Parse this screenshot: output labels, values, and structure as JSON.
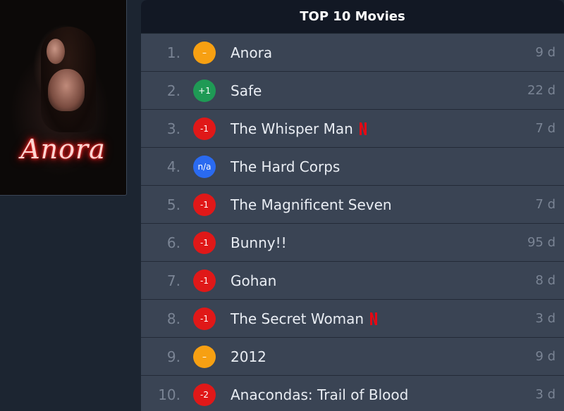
{
  "poster": {
    "title": "Anora"
  },
  "list": {
    "header": "TOP 10 Movies",
    "rows": [
      {
        "rank": "1.",
        "change": "–",
        "change_color": "#f7a012",
        "title": "Anora",
        "netflix": false,
        "days": "9 d"
      },
      {
        "rank": "2.",
        "change": "+1",
        "change_color": "#1f9a55",
        "title": "Safe",
        "netflix": false,
        "days": "22 d"
      },
      {
        "rank": "3.",
        "change": "-1",
        "change_color": "#e01818",
        "title": "The Whisper Man",
        "netflix": true,
        "days": "7 d"
      },
      {
        "rank": "4.",
        "change": "n/a",
        "change_color": "#2a6af0",
        "title": "The Hard Corps",
        "netflix": false,
        "days": ""
      },
      {
        "rank": "5.",
        "change": "-1",
        "change_color": "#e01818",
        "title": "The Magnificent Seven",
        "netflix": false,
        "days": "7 d"
      },
      {
        "rank": "6.",
        "change": "-1",
        "change_color": "#e01818",
        "title": "Bunny!!",
        "netflix": false,
        "days": "95 d"
      },
      {
        "rank": "7.",
        "change": "-1",
        "change_color": "#e01818",
        "title": "Gohan",
        "netflix": false,
        "days": "8 d"
      },
      {
        "rank": "8.",
        "change": "-1",
        "change_color": "#e01818",
        "title": "The Secret Woman",
        "netflix": true,
        "days": "3 d"
      },
      {
        "rank": "9.",
        "change": "–",
        "change_color": "#f7a012",
        "title": "2012",
        "netflix": false,
        "days": "9 d"
      },
      {
        "rank": "10.",
        "change": "-2",
        "change_color": "#e01818",
        "title": "Anacondas: Trail of Blood",
        "netflix": false,
        "days": "3 d"
      }
    ]
  },
  "icons": {
    "netflix": "netflix-logo-icon"
  },
  "colors": {
    "netflix_red": "#e50914"
  }
}
